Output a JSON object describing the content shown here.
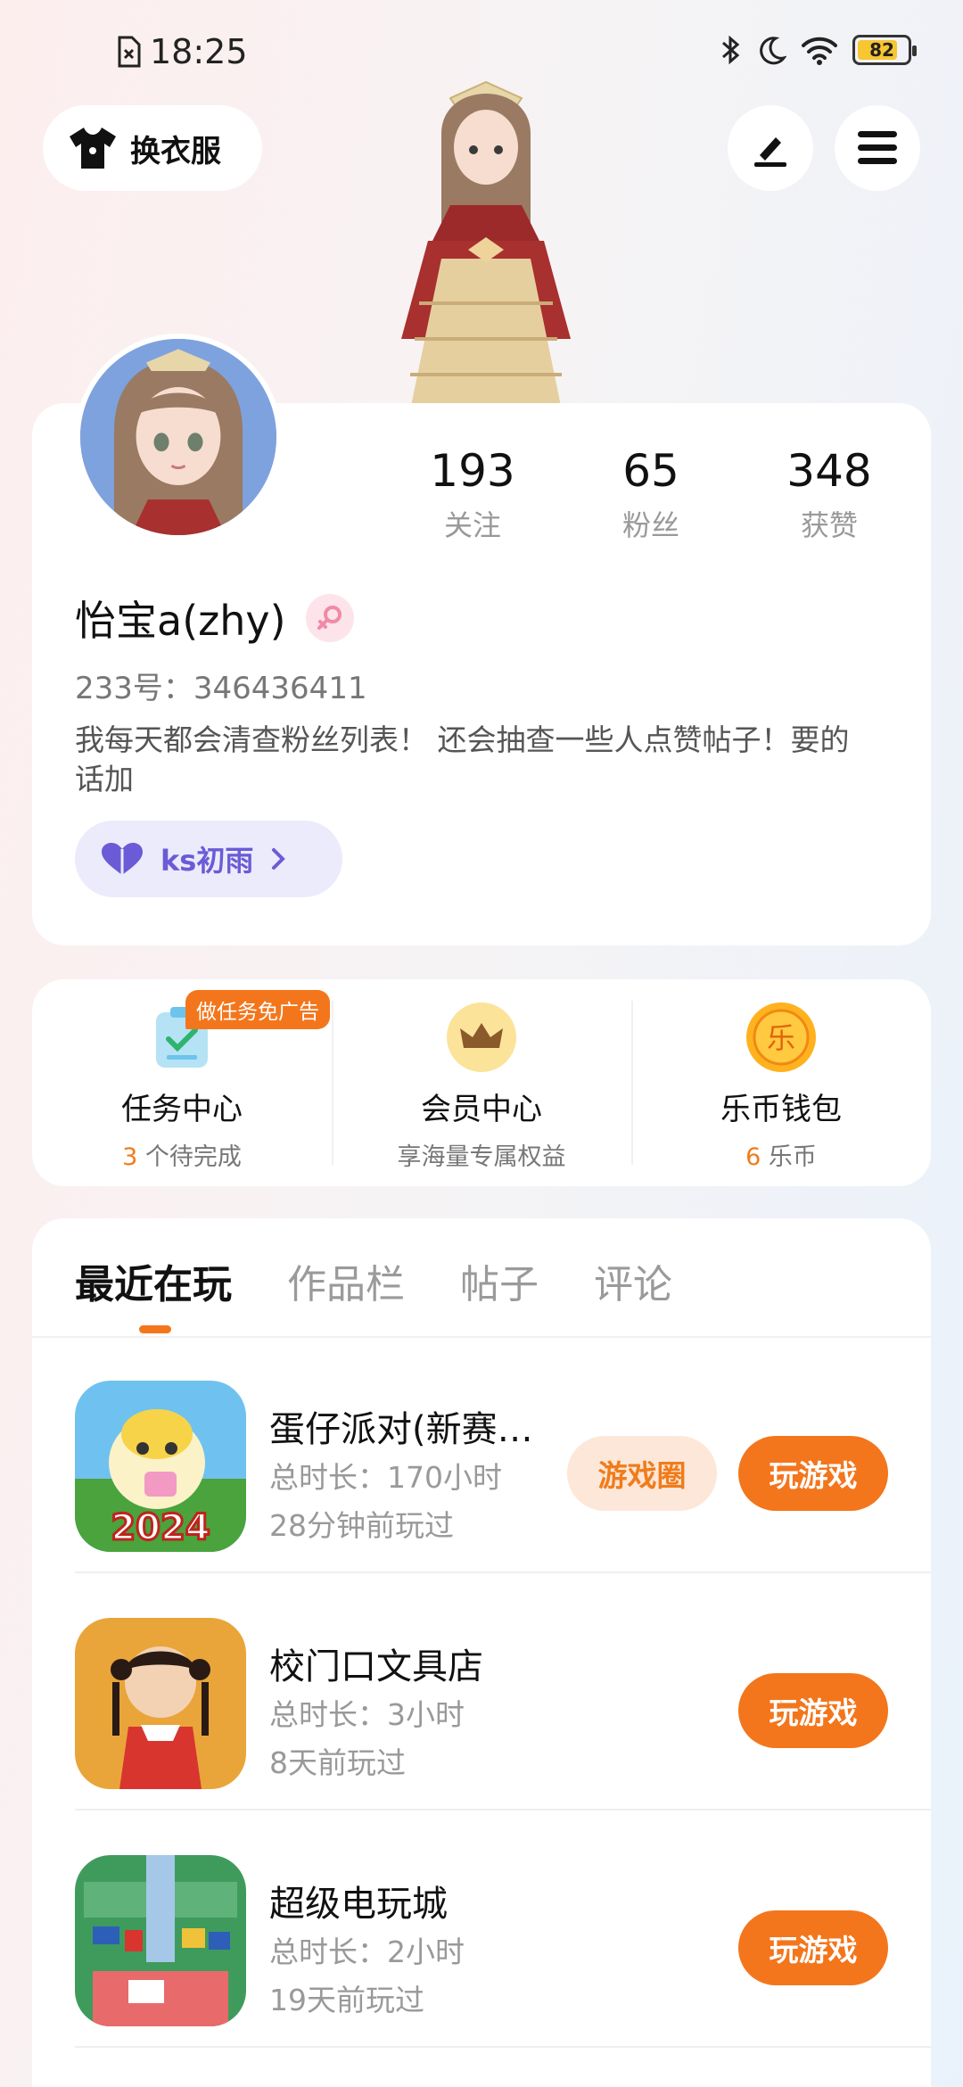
{
  "status_bar": {
    "time": "18:25",
    "battery": "82",
    "battery_level": 0.82
  },
  "top": {
    "outfit_label": "换衣服",
    "outfit_icon": "shirt-icon",
    "edit_icon": "pen-icon",
    "menu_icon": "menu-icon"
  },
  "profile": {
    "stats": [
      {
        "value": "193",
        "label": "关注"
      },
      {
        "value": "65",
        "label": "粉丝"
      },
      {
        "value": "348",
        "label": "获赞"
      }
    ],
    "nickname": "怡宝a(zhy)",
    "uid": "233号：346436411",
    "bio": "我每天都会清查粉丝列表！ 还会抽查一些人点赞帖子！要的话加",
    "tag": "ks初雨"
  },
  "services": [
    {
      "title": "任务中心",
      "count": "3",
      "suffix": " 个待完成",
      "badge": "做任务免广告"
    },
    {
      "title": "会员中心",
      "subtitle": "享海量专属权益"
    },
    {
      "title": "乐币钱包",
      "count": "6",
      "suffix": " 乐币",
      "coin_char": "乐"
    }
  ],
  "tabs": [
    "最近在玩",
    "作品栏",
    "帖子",
    "评论"
  ],
  "games": [
    {
      "title": "蛋仔派对(新赛季)",
      "duration": "总时长：170小时",
      "last_played": "28分钟前玩过",
      "circle_label": "游戏圈",
      "play_label": "玩游戏",
      "icon_text": "2024"
    },
    {
      "title": "校门口文具店",
      "duration": "总时长：3小时",
      "last_played": "8天前玩过",
      "play_label": "玩游戏"
    },
    {
      "title": "超级电玩城",
      "duration": "总时长：2小时",
      "last_played": "19天前玩过",
      "play_label": "玩游戏"
    }
  ],
  "colors": {
    "accent": "#f3761c",
    "tag_purple": "#6b5bd6",
    "battery": "#f7c631"
  }
}
